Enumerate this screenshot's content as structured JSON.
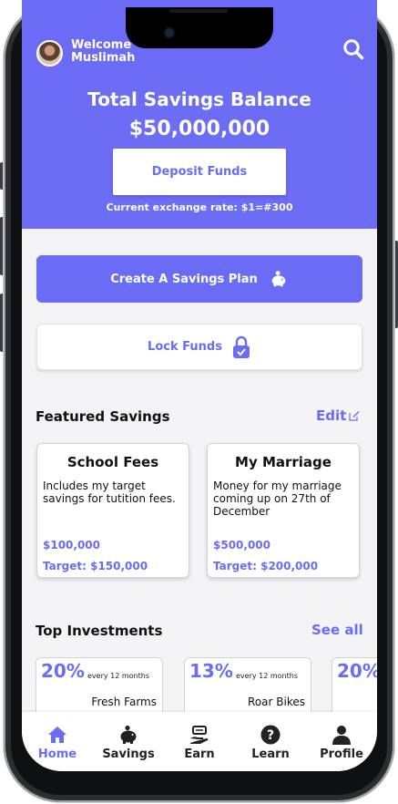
{
  "header": {
    "welcome_line1": "Welcome",
    "welcome_line2": "Muslimah",
    "balance_title": "Total Savings Balance",
    "balance_amount": "$50,000,000",
    "deposit_label": "Deposit Funds",
    "exchange_rate": "Current exchange rate: $1=#300"
  },
  "actions": {
    "create_plan_label": "Create A Savings Plan",
    "lock_funds_label": "Lock Funds"
  },
  "featured": {
    "title": "Featured Savings",
    "edit_label": "Edit",
    "cards": [
      {
        "title": "School Fees",
        "description": "Includes my target savings for tutition fees.",
        "amount": "$100,000",
        "target": "Target: $150,000"
      },
      {
        "title": "My Marriage",
        "description": "Money for my marriage coming up on 27th of December",
        "amount": "$500,000",
        "target": "Target: $200,000"
      }
    ]
  },
  "investments": {
    "title": "Top Investments",
    "see_all_label": "See all",
    "cards": [
      {
        "percent": "20%",
        "period": "every 12 months",
        "name": "Fresh Farms"
      },
      {
        "percent": "13%",
        "period": "every 12 months",
        "name": "Roar Bikes"
      },
      {
        "percent": "20%",
        "period": "",
        "name": ""
      }
    ]
  },
  "nav": {
    "items": [
      {
        "label": "Home",
        "icon": "home-icon"
      },
      {
        "label": "Savings",
        "icon": "piggy-bank-icon"
      },
      {
        "label": "Earn",
        "icon": "earn-hand-icon"
      },
      {
        "label": "Learn",
        "icon": "question-icon"
      },
      {
        "label": "Profile",
        "icon": "user-icon"
      }
    ],
    "active": "Home"
  },
  "colors": {
    "accent": "#6b6cf5",
    "background": "#f4f4f6"
  }
}
